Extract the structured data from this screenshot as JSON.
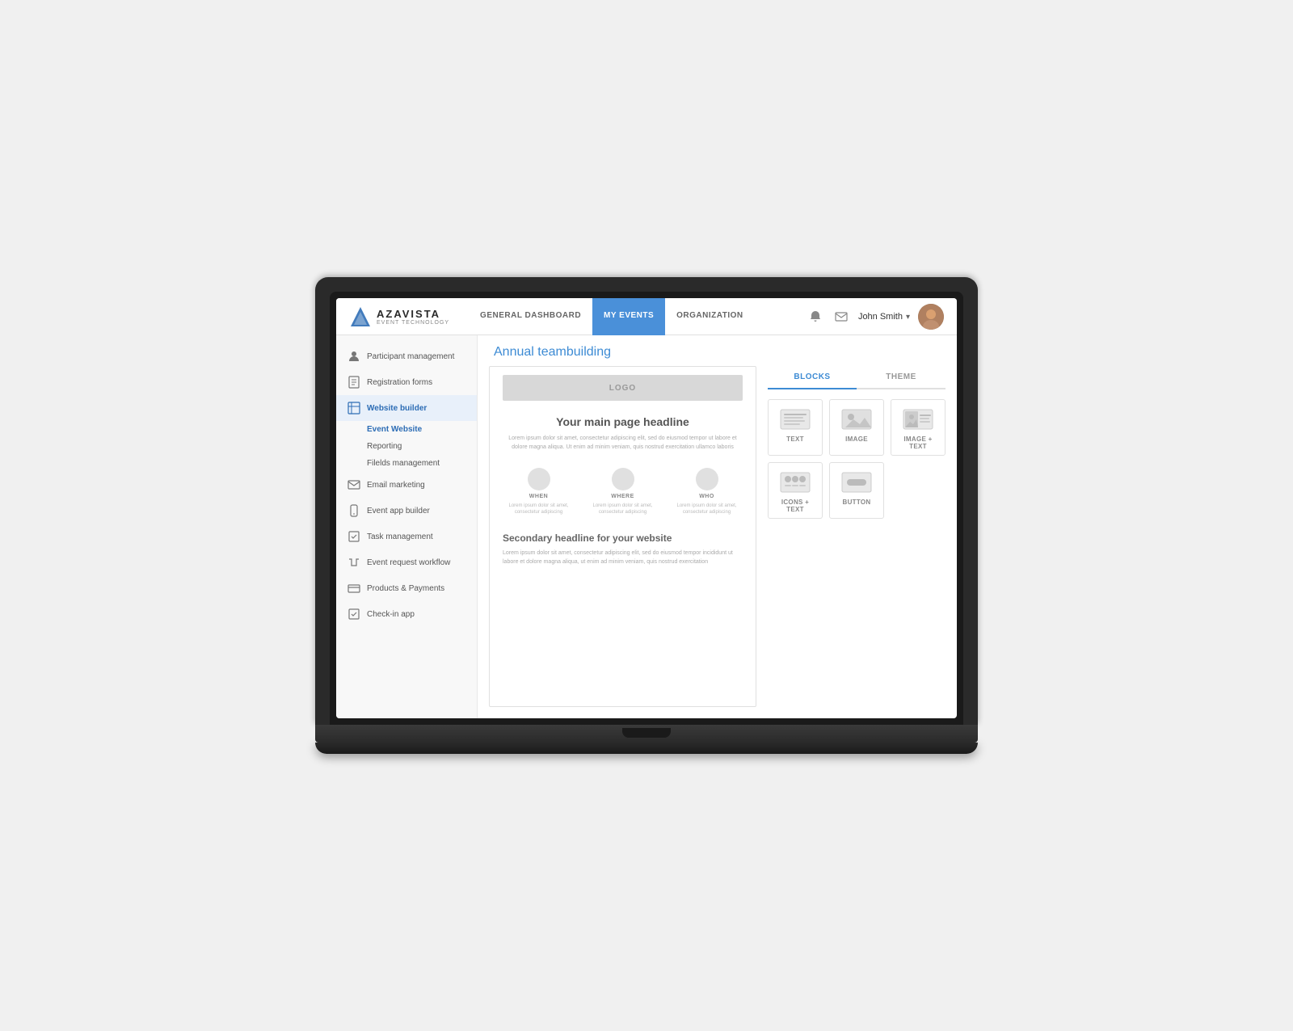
{
  "laptop": {
    "visible": true
  },
  "nav": {
    "logo_brand": "AZAVISTA",
    "logo_sub": "EVENT TECHNOLOGY",
    "links": [
      {
        "id": "general-dashboard",
        "label": "GENERAL DASHBOARD",
        "active": false
      },
      {
        "id": "my-events",
        "label": "MY EVENTS",
        "active": true
      },
      {
        "id": "organization",
        "label": "ORGANIZATION",
        "active": false
      }
    ],
    "user_name": "John Smith",
    "notification_icon": "🔔",
    "message_icon": "✉"
  },
  "sidebar": {
    "items": [
      {
        "id": "participant-management",
        "label": "Participant management",
        "icon": "person"
      },
      {
        "id": "registration-forms",
        "label": "Registration forms",
        "icon": "form"
      },
      {
        "id": "website-builder",
        "label": "Website builder",
        "icon": "chart",
        "active": true
      },
      {
        "id": "email-marketing",
        "label": "Email marketing",
        "icon": "email"
      },
      {
        "id": "event-app-builder",
        "label": "Event app builder",
        "icon": "app"
      },
      {
        "id": "task-management",
        "label": "Task management",
        "icon": "task"
      },
      {
        "id": "event-request-workflow",
        "label": "Event request workflow",
        "icon": "workflow"
      },
      {
        "id": "products-payments",
        "label": "Products & Payments",
        "icon": "payment"
      },
      {
        "id": "check-in-app",
        "label": "Check-in app",
        "icon": "checkin"
      }
    ],
    "sub_items": [
      {
        "id": "event-website",
        "label": "Event Website",
        "active": true
      },
      {
        "id": "reporting",
        "label": "Reporting",
        "active": false
      },
      {
        "id": "filelds-management",
        "label": "Filelds management",
        "active": false
      }
    ]
  },
  "page": {
    "title": "Annual teambuilding"
  },
  "blocks": {
    "tabs": [
      {
        "id": "blocks",
        "label": "BLOCKS",
        "active": true
      },
      {
        "id": "theme",
        "label": "THEME",
        "active": false
      }
    ],
    "items": [
      {
        "id": "text",
        "label": "TEXT",
        "type": "text"
      },
      {
        "id": "image",
        "label": "IMAGE",
        "type": "image"
      },
      {
        "id": "image-text",
        "label": "IMAGE + TEXT",
        "type": "image-text"
      },
      {
        "id": "icons-text",
        "label": "ICONS + TEXT",
        "type": "icons-text"
      },
      {
        "id": "button",
        "label": "BUTTON",
        "type": "button"
      }
    ]
  },
  "preview": {
    "logo_placeholder": "LOGO",
    "hero_headline": "Your main page headline",
    "hero_text": "Lorem ipsum dolor sit amet, consectetur adipiscing elit, sed do eiusmod tempor ut labore et dolore magna aliqua. Ut enim ad minim veniam, quis nostrud exercitation ullamco laboris",
    "when_label": "WHEN",
    "when_text": "Lorem ipsum dolor sit amet, consectetur adipiscing",
    "where_label": "WHERE",
    "where_text": "Lorem ipsum dolor sit amet, consectetur adipiscing",
    "who_label": "WHO",
    "who_text": "Lorem ipsum dolor sit amet, consectetur adipiscing",
    "secondary_headline": "Secondary headline for your website",
    "secondary_text": "Lorem ipsum dolor sit amet, consectetur adipiscing elit, sed do eiusmod tempor incididunt ut labore et dolore magna aliqua, ut enim ad minim veniam, quis nostrud exercitation"
  }
}
